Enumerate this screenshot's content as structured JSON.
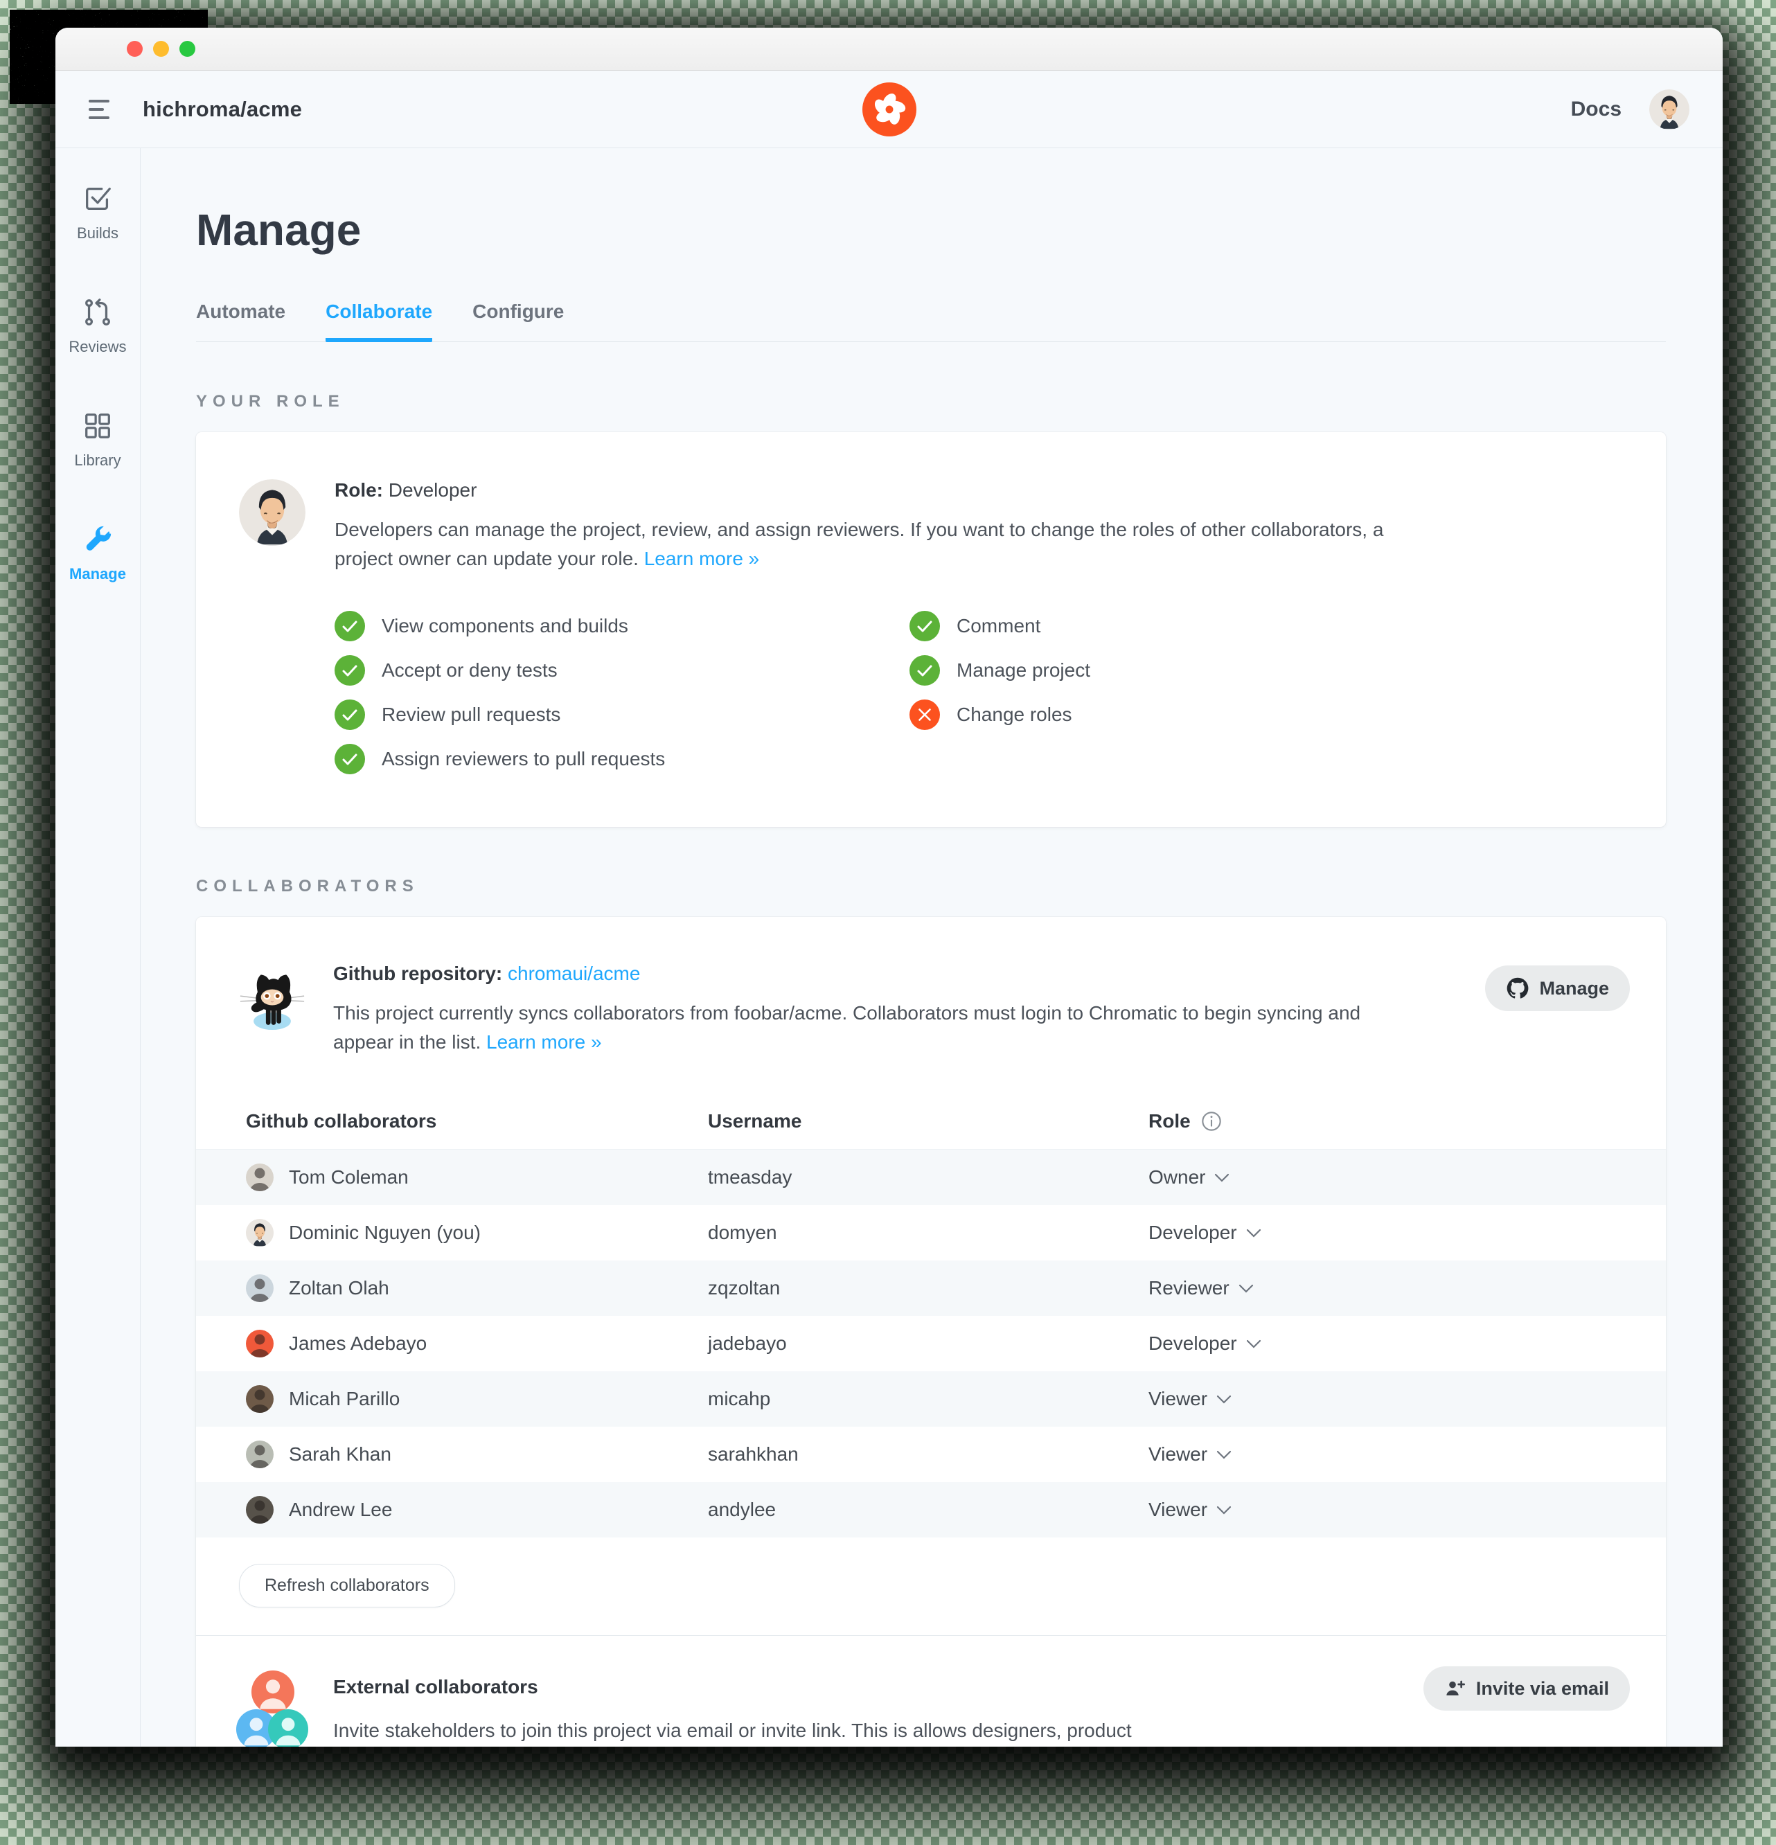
{
  "header": {
    "project_name": "hichroma/acme",
    "docs_label": "Docs"
  },
  "sidebar": {
    "items": [
      {
        "label": "Builds",
        "icon": "builds-icon",
        "active": false
      },
      {
        "label": "Reviews",
        "icon": "reviews-icon",
        "active": false
      },
      {
        "label": "Library",
        "icon": "library-icon",
        "active": false
      },
      {
        "label": "Manage",
        "icon": "manage-icon",
        "active": true
      }
    ]
  },
  "page": {
    "title": "Manage",
    "tabs": [
      {
        "label": "Automate",
        "active": false
      },
      {
        "label": "Collaborate",
        "active": true
      },
      {
        "label": "Configure",
        "active": false
      }
    ]
  },
  "your_role": {
    "section_label": "YOUR ROLE",
    "role_label": "Role:",
    "role_value": "Developer",
    "description": "Developers can manage the project, review, and assign reviewers. If you want to change the roles of other collaborators, a project owner can update your role.",
    "learn_more_label": "Learn more »",
    "permissions_left": [
      {
        "label": "View components and builds",
        "allowed": true
      },
      {
        "label": "Accept or deny tests",
        "allowed": true
      },
      {
        "label": "Review pull requests",
        "allowed": true
      },
      {
        "label": "Assign reviewers to pull requests",
        "allowed": true
      }
    ],
    "permissions_right": [
      {
        "label": "Comment",
        "allowed": true
      },
      {
        "label": "Manage project",
        "allowed": true
      },
      {
        "label": "Change roles",
        "allowed": false
      }
    ]
  },
  "collaborators": {
    "section_label": "COLLABORATORS",
    "repo_label": "Github repository:",
    "repo_link": "chromaui/acme",
    "repo_description": "This project currently syncs collaborators from foobar/acme. Collaborators must login to Chromatic to begin syncing and appear in the list.",
    "learn_more_label": "Learn more »",
    "manage_button_label": "Manage",
    "table": {
      "columns": [
        "Github collaborators",
        "Username",
        "Role"
      ],
      "rows": [
        {
          "name": "Tom Coleman",
          "username": "tmeasday",
          "role": "Owner",
          "avatar_color": "#d9d4cc"
        },
        {
          "name": "Dominic Nguyen (you)",
          "username": "domyen",
          "role": "Developer",
          "avatar_color": "#eae6e1"
        },
        {
          "name": "Zoltan Olah",
          "username": "zqzoltan",
          "role": "Reviewer",
          "avatar_color": "#ccd6dd"
        },
        {
          "name": "James Adebayo",
          "username": "jadebayo",
          "role": "Developer",
          "avatar_color": "#f0593a"
        },
        {
          "name": "Micah Parillo",
          "username": "micahp",
          "role": "Viewer",
          "avatar_color": "#6e5a48"
        },
        {
          "name": "Sarah Khan",
          "username": "sarahkhan",
          "role": "Viewer",
          "avatar_color": "#b9bdb4"
        },
        {
          "name": "Andrew Lee",
          "username": "andylee",
          "role": "Viewer",
          "avatar_color": "#57524a"
        }
      ]
    },
    "refresh_button_label": "Refresh collaborators",
    "external": {
      "title": "External collaborators",
      "description": "Invite stakeholders to join this project via email or invite link. This is allows designers, product",
      "invite_button_label": "Invite via email"
    }
  },
  "colors": {
    "accent_blue": "#1EA7FD",
    "allowed_green": "#5CB238",
    "denied_red": "#FC521F",
    "brand_orange": "#FC521F"
  }
}
